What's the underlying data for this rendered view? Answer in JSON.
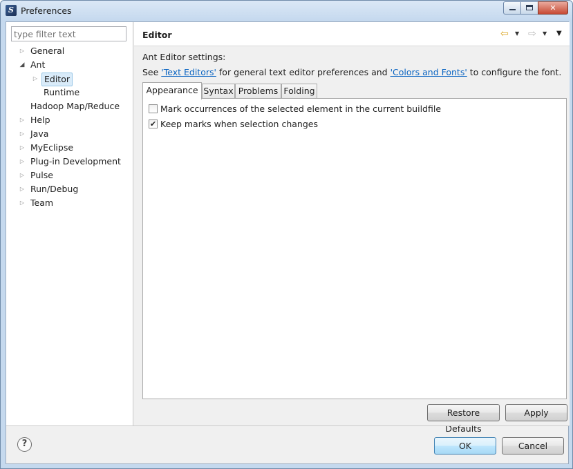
{
  "window": {
    "title": "Preferences",
    "minimize": "",
    "maximize": "",
    "close": "✕"
  },
  "filter": {
    "placeholder": "type filter text"
  },
  "tree": [
    {
      "label": "General",
      "expandable": true,
      "expanded": false,
      "level": 0
    },
    {
      "label": "Ant",
      "expandable": true,
      "expanded": true,
      "level": 0
    },
    {
      "label": "Editor",
      "expandable": true,
      "expanded": false,
      "level": 1,
      "selected": true
    },
    {
      "label": "Runtime",
      "expandable": false,
      "level": 1
    },
    {
      "label": "Hadoop Map/Reduce",
      "expandable": false,
      "level": 0
    },
    {
      "label": "Help",
      "expandable": true,
      "expanded": false,
      "level": 0
    },
    {
      "label": "Java",
      "expandable": true,
      "expanded": false,
      "level": 0
    },
    {
      "label": "MyEclipse",
      "expandable": true,
      "expanded": false,
      "level": 0
    },
    {
      "label": "Plug-in Development",
      "expandable": true,
      "expanded": false,
      "level": 0
    },
    {
      "label": "Pulse",
      "expandable": true,
      "expanded": false,
      "level": 0
    },
    {
      "label": "Run/Debug",
      "expandable": true,
      "expanded": false,
      "level": 0
    },
    {
      "label": "Team",
      "expandable": true,
      "expanded": false,
      "level": 0
    }
  ],
  "page": {
    "title": "Editor",
    "settings_label": "Ant Editor settings:",
    "see_prefix": "See ",
    "link_text_editors": "'Text Editors'",
    "see_middle": " for general text editor preferences and ",
    "link_colors_fonts": "'Colors and Fonts'",
    "see_suffix": " to configure the font."
  },
  "nav": {
    "back_icon": "back-arrow-icon",
    "forward_icon": "forward-arrow-icon"
  },
  "tabs": [
    {
      "label": "Appearance",
      "active": true
    },
    {
      "label": "Syntax",
      "active": false
    },
    {
      "label": "Problems",
      "active": false
    },
    {
      "label": "Folding",
      "active": false
    }
  ],
  "options": [
    {
      "label": "Mark occurrences of the selected element in the current buildfile",
      "checked": false
    },
    {
      "label": "Keep marks when selection changes",
      "checked": true
    }
  ],
  "buttons": {
    "restore_defaults": "Restore Defaults",
    "apply": "Apply",
    "ok": "OK",
    "cancel": "Cancel"
  },
  "colors": {
    "link": "#0b65c2",
    "selection": "#d9ebf9",
    "back_arrow": "#d9a31d"
  }
}
